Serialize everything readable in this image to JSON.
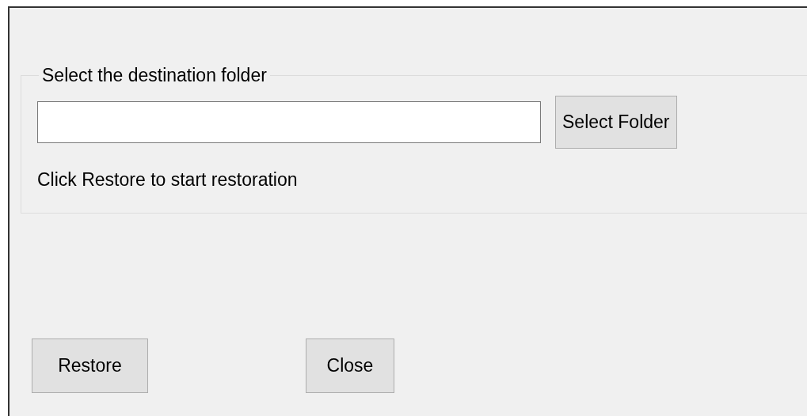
{
  "destination_group": {
    "title": "Select the destination folder",
    "select_button": "Select Folder",
    "hint": "Click Restore to start restoration"
  },
  "buttons": [
    "Restore",
    "Close"
  ]
}
